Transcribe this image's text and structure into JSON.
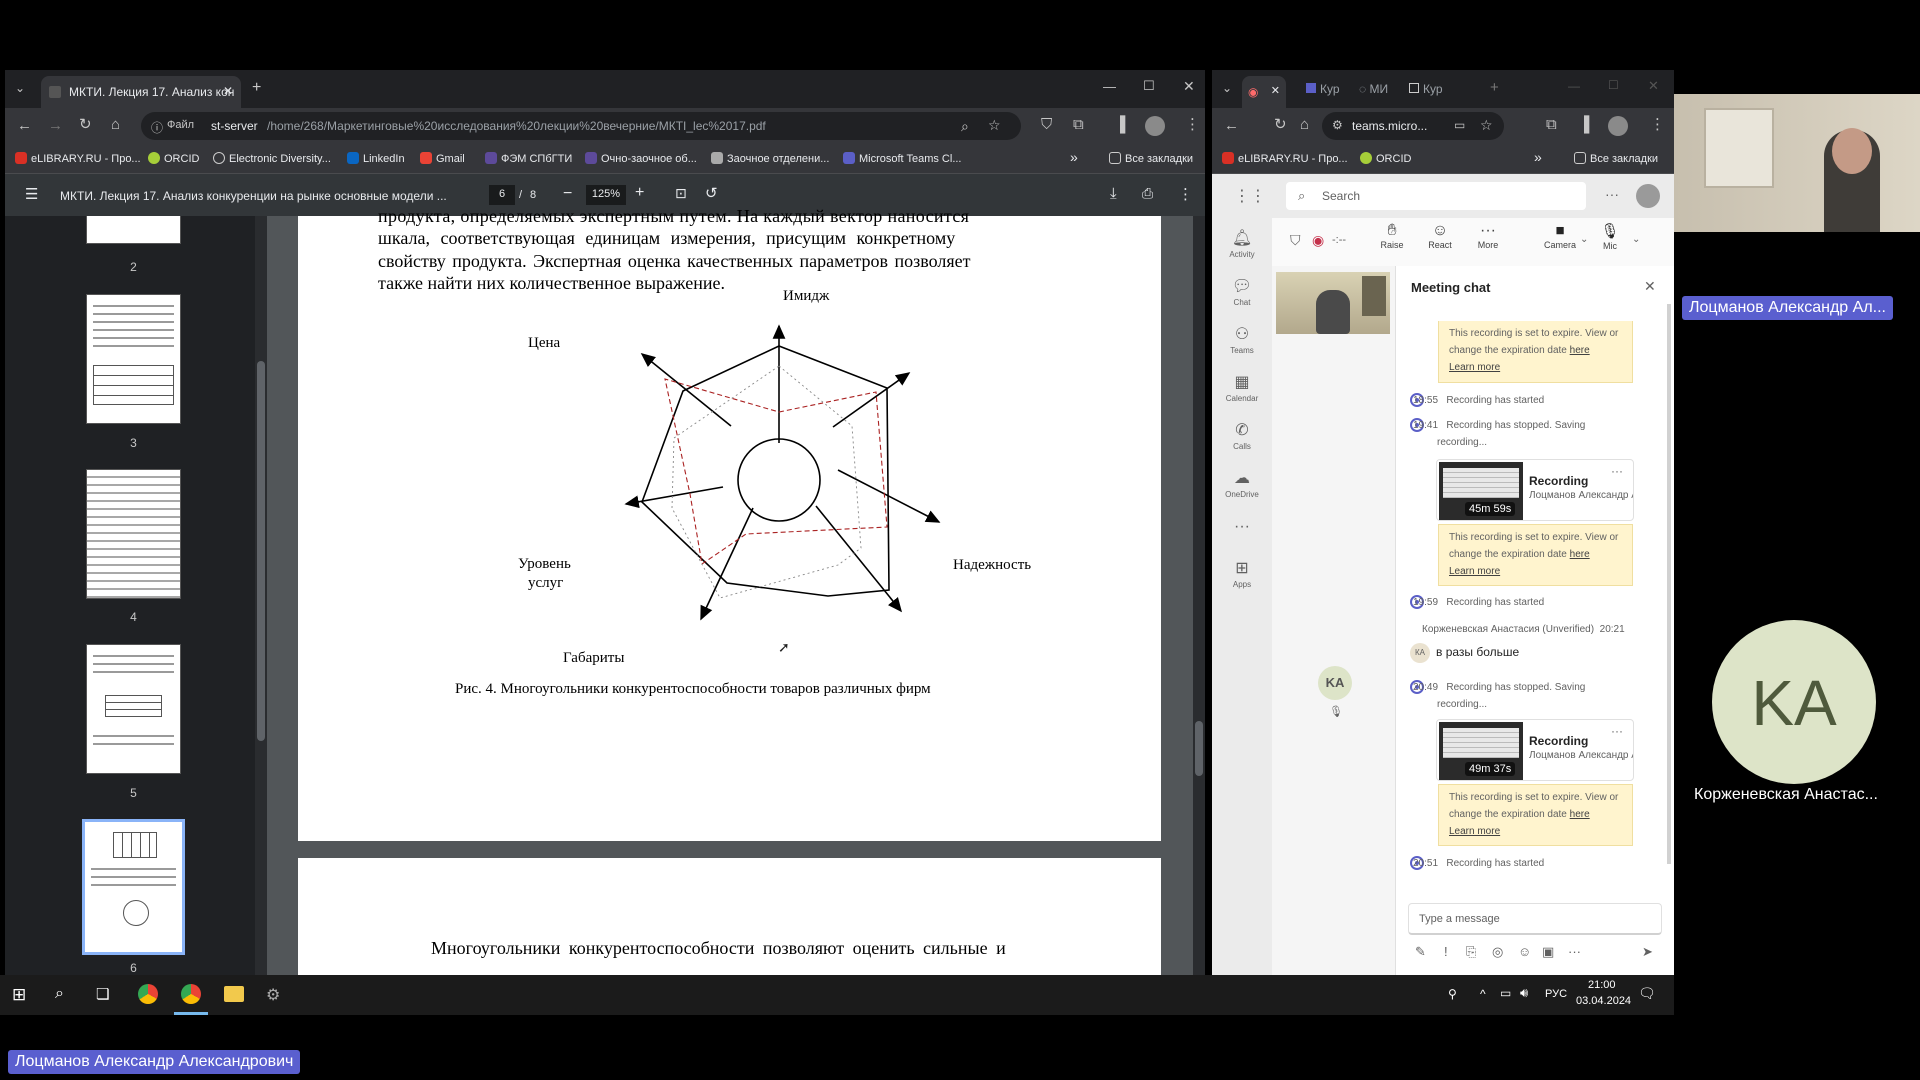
{
  "pdf_browser": {
    "tab_title": "МКТИ. Лекция 17. Анализ кон",
    "omnibox_label": "Файл",
    "url_host": "st-server",
    "url_path": "/home/268/Маркетинговые%20исследования%20лекции%20вечерние/МКТI_lec%2017.pdf",
    "bookmarks": [
      "eLIBRARY.RU - Про...",
      "ORCID",
      "Electronic Diversity...",
      "LinkedIn",
      "Gmail",
      "ФЭМ СПбГТИ",
      "Очно-заочное об...",
      "Заочное отделени...",
      "Microsoft Teams Cl..."
    ],
    "all_bookmarks": "Все закладки",
    "chevron": "»"
  },
  "pdf_viewer": {
    "doc_title": "МКТИ. Лекция 17. Анализ конкуренции на рынке основные модели ...",
    "page_current": "6",
    "page_sep": "/",
    "page_total": "8",
    "zoom": "125%",
    "thumb_numbers": [
      "2",
      "3",
      "4",
      "5",
      "6"
    ]
  },
  "pdf_page": {
    "line_cut": "продукта, определяемых экспертным путем. На каждый вектор наносится",
    "line1": "шкала, соответствующая единицам измерения, присущим конкретному",
    "line2": "свойству продукта. Экспертная оценка качественных параметров позволяет",
    "line3": "также найти них количественное выражение.",
    "labels": {
      "image": "Имидж",
      "price": "Цена",
      "reliability": "Надежность",
      "service_1": "Уровень",
      "service_2": "услуг",
      "dimensions": "Габариты"
    },
    "caption": "Рис. 4. Многоугольники конкурентоспособности товаров различных фирм",
    "next_page_text": "Многоугольники конкурентоспособности позволяют оценить сильные и"
  },
  "teams_browser": {
    "tabs": [
      "Кур",
      "МИ",
      "Кур"
    ],
    "url_host": "teams.micro...",
    "bookmarks": [
      "eLIBRARY.RU - Про...",
      "ORCID"
    ],
    "all_bookmarks": "Все закладки",
    "chevron": "»"
  },
  "teams": {
    "search_placeholder": "Search",
    "rail": [
      "Activity",
      "Chat",
      "Teams",
      "Calendar",
      "Calls",
      "OneDrive",
      "Apps"
    ],
    "meeting_timer": "-:--",
    "controls": [
      "Raise",
      "React",
      "More",
      "Camera",
      "Mic"
    ],
    "chat_title": "Meeting chat",
    "notice_text_1": "This recording is set to expire. View or",
    "notice_text_2": "change the expiration date",
    "notice_here": "here",
    "notice_learn": "Learn more",
    "events": [
      {
        "time": "18:55",
        "text": "Recording has started"
      },
      {
        "time": "19:41",
        "text": "Recording has stopped. Saving",
        "text2": "recording..."
      },
      {
        "time": "19:59",
        "text": "Recording has started"
      },
      {
        "time": "20:49",
        "text": "Recording has stopped. Saving",
        "text2": "recording..."
      },
      {
        "time": "20:51",
        "text": "Recording has started"
      }
    ],
    "recordings": [
      {
        "title": "Recording",
        "owner": "Лоцманов Александр А...",
        "duration": "45m 59s"
      },
      {
        "title": "Recording",
        "owner": "Лоцманов Александр А...",
        "duration": "49m 37s"
      }
    ],
    "message_author": "Корженевская Анастасия (Unverified)",
    "message_time": "20:21",
    "message_avatar": "КА",
    "message_text": "в разы больше",
    "ka_avatar": "KA",
    "compose_placeholder": "Type a message"
  },
  "taskbar": {
    "lang": "РУС",
    "time": "21:00",
    "date": "03.04.2024"
  },
  "participants": {
    "speaker_name": "Лоцманов Александр Ал...",
    "other_initials": "KA",
    "other_name": "Корженевская Анастас...",
    "bottom_name": "Лоцманов Александр Александрович"
  },
  "colors": {
    "chrome_dark": "#202124",
    "teams_purple": "#5b5fc7",
    "name_tag": "#5a5fcf",
    "notice_bg": "#fff4ce",
    "avatar_bg": "#dde4c8"
  }
}
